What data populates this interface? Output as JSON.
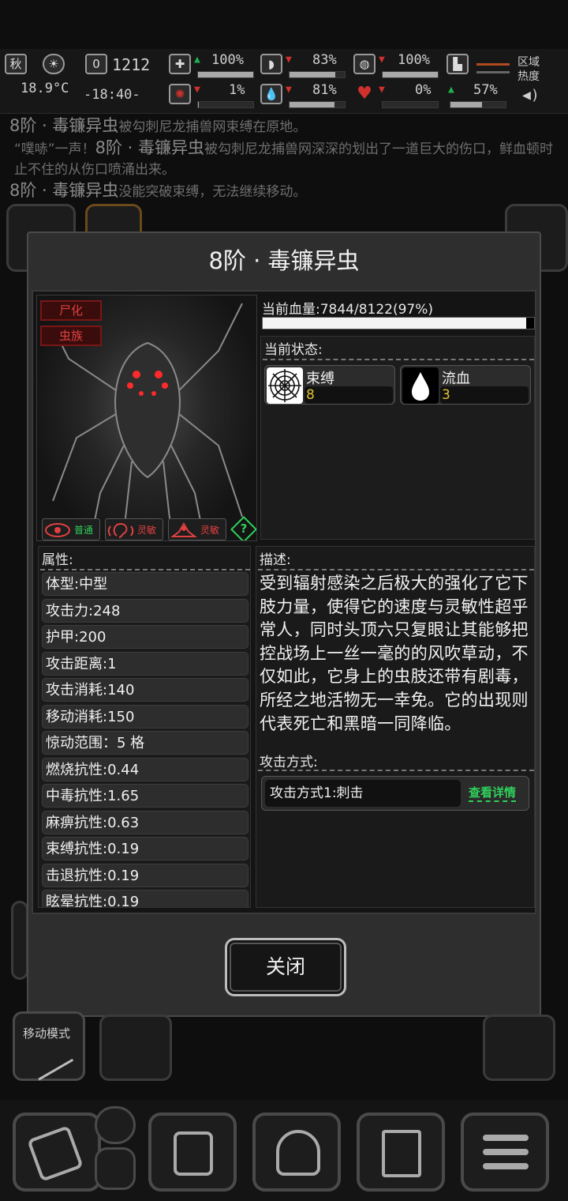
{
  "status_bar": {
    "season": "秋",
    "temperature": "18.9°C",
    "day": "0",
    "clock_top": "1212",
    "clock": "-18:40-",
    "stats": [
      {
        "icon": "medkit-icon",
        "trend": "up",
        "value": "100%",
        "level": 1.0
      },
      {
        "icon": "stomach-icon",
        "trend": "down",
        "value": "83%",
        "level": 0.83
      },
      {
        "icon": "mask-icon",
        "trend": "down",
        "value": "100%",
        "level": 1.0
      },
      {
        "icon": "leg-icon",
        "trend": "none",
        "value": "",
        "level": 0
      },
      {
        "icon": "brain-icon",
        "trend": "down",
        "value": "1%",
        "level": 0.01
      },
      {
        "icon": "water-drop-icon",
        "trend": "down",
        "value": "81%",
        "level": 0.81
      },
      {
        "icon": "heart-icon",
        "trend": "down",
        "value": "0%",
        "level": 0.0
      },
      {
        "icon": "stamina-icon",
        "trend": "up",
        "value": "57%",
        "level": 0.57
      }
    ],
    "region_heat_label": "区域热度"
  },
  "log": {
    "line1_a": "8阶 · 毒镰异虫",
    "line1_b": "被勾刺尼龙捕兽网束缚在原地。",
    "line2_a": "“噗哧”一声！",
    "line2_b": "8阶 · 毒镰异虫",
    "line2_c": "被勾刺尼龙捕兽网深深的划出了一道巨大的伤口，鲜血顿时止不住的从伤口喷涌出来。",
    "line3_a": "8阶 · 毒镰异虫",
    "line3_b": "没能突破束缚，无法继续移动。"
  },
  "dialog": {
    "title": "8阶 · 毒镰异虫",
    "tags": [
      "尸化",
      "虫族"
    ],
    "traits": [
      {
        "icon": "eye-icon",
        "label": "普通",
        "color": "#2fd05a"
      },
      {
        "icon": "ear-icon",
        "label": "灵敏",
        "color": "#e04040"
      },
      {
        "icon": "sense-icon",
        "label": "灵敏",
        "color": "#e04040"
      }
    ],
    "help_glyph": "?",
    "hp_label": "当前血量:7844/8122(97%)",
    "hp_fraction": 0.97,
    "state_label": "当前状态:",
    "statuses": [
      {
        "icon": "web-icon",
        "name": "束缚",
        "value": "8"
      },
      {
        "icon": "blood-drop-icon",
        "name": "流血",
        "value": "3"
      }
    ],
    "attr_label": "属性:",
    "attributes": [
      "体型:中型",
      "攻击力:248",
      "护甲:200",
      "攻击距离:1",
      "攻击消耗:140",
      "移动消耗:150",
      "惊动范围：5 格",
      "燃烧抗性:0.44",
      "中毒抗性:1.65",
      "麻痹抗性:0.63",
      "束缚抗性:0.19",
      "击退抗性:0.19",
      "眩晕抗性:0.19"
    ],
    "desc_label": "描述:",
    "description": "受到辐射感染之后极大的强化了它下肢力量，使得它的速度与灵敏性超乎常人，同时头顶六只复眼让其能够把控战场上一丝一毫的的风吹草动，不仅如此，它身上的虫肢还带有剧毒，所经之地活物无一幸免。它的出现则代表死亡和黑暗一同降临。",
    "attack_label": "攻击方式:",
    "attacks": [
      {
        "name": "攻击方式1:刺击",
        "detail": "查看详情"
      }
    ],
    "close_label": "关闭"
  },
  "bottom": {
    "move_mode_label": "移动模式"
  }
}
